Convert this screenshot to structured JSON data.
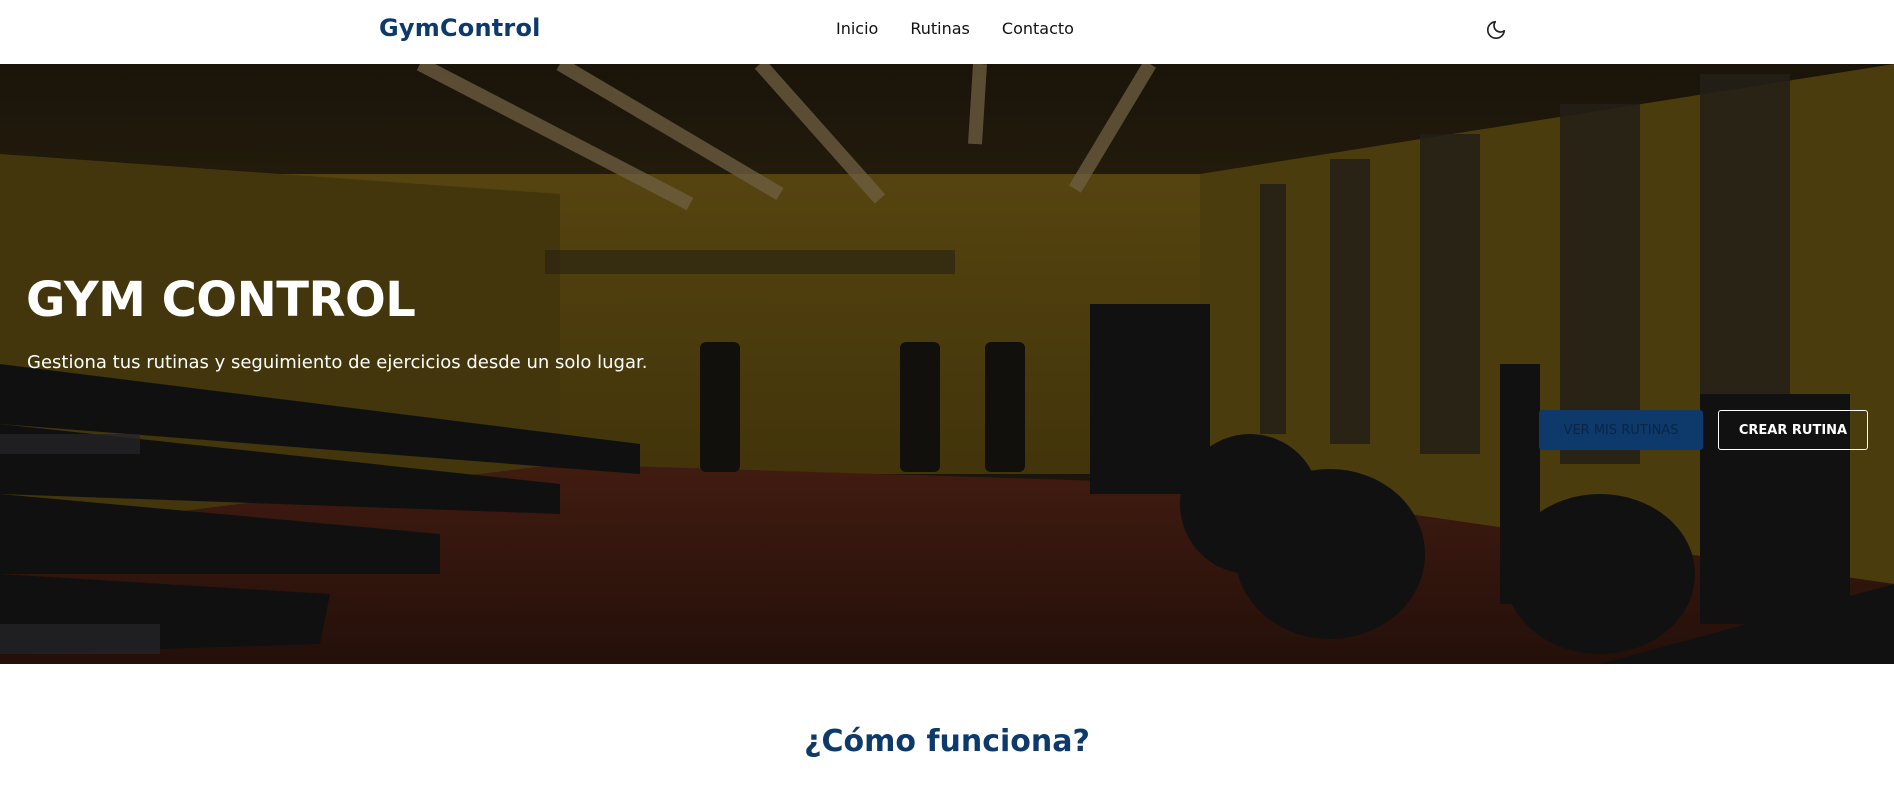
{
  "navbar": {
    "brand": "GymControl",
    "links": [
      {
        "label": "Inicio"
      },
      {
        "label": "Rutinas"
      },
      {
        "label": "Contacto"
      }
    ],
    "theme_toggle_icon": "moon-icon"
  },
  "hero": {
    "title": "GYM CONTROL",
    "subtitle": "Gestiona tus rutinas y seguimiento de ejercicios desde un solo lugar.",
    "primary_button": "VER MIS RUTINAS",
    "secondary_button": "CREAR RUTINA",
    "background_image": "gym-interior-photo"
  },
  "how_it_works": {
    "title": "¿Cómo funciona?"
  },
  "colors": {
    "brand": "#0d3a6b",
    "nav_background": "#ffffff",
    "hero_overlay": "#000000"
  }
}
